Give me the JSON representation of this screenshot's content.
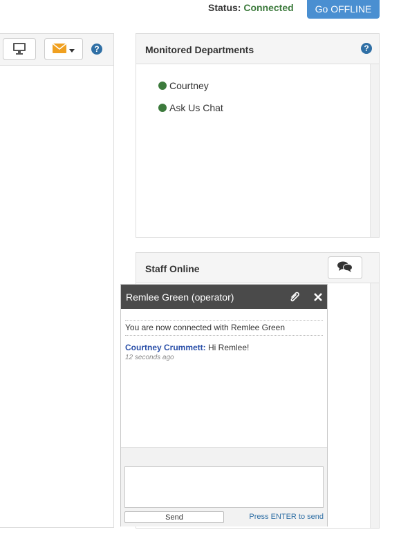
{
  "header": {
    "status_label": "Status:",
    "status_value": "Connected",
    "offline_button": "Go OFFLINE"
  },
  "left_toolbar": {
    "icons": [
      "monitor-icon",
      "envelope-icon",
      "caret-down-icon",
      "help-icon"
    ]
  },
  "departments_panel": {
    "title": "Monitored Departments",
    "items": [
      {
        "label": "Courtney",
        "status": "online"
      },
      {
        "label": "Ask Us Chat",
        "status": "online"
      }
    ]
  },
  "staff_panel": {
    "title": "Staff Online"
  },
  "chat_window": {
    "title": "Remlee Green (operator)",
    "system_message": "You are now connected with Remlee Green",
    "messages": [
      {
        "sender": "Courtney Crummett:",
        "text": "Hi Remlee!",
        "time": "12 seconds ago"
      }
    ],
    "send_label": "Send",
    "enter_hint": "Press ENTER to send"
  },
  "colors": {
    "accent": "#4a8fd1",
    "online": "#3c7a3c",
    "chat_header": "#4a4a4a",
    "envelope": "#f0a020",
    "link": "#2f6fa5"
  }
}
